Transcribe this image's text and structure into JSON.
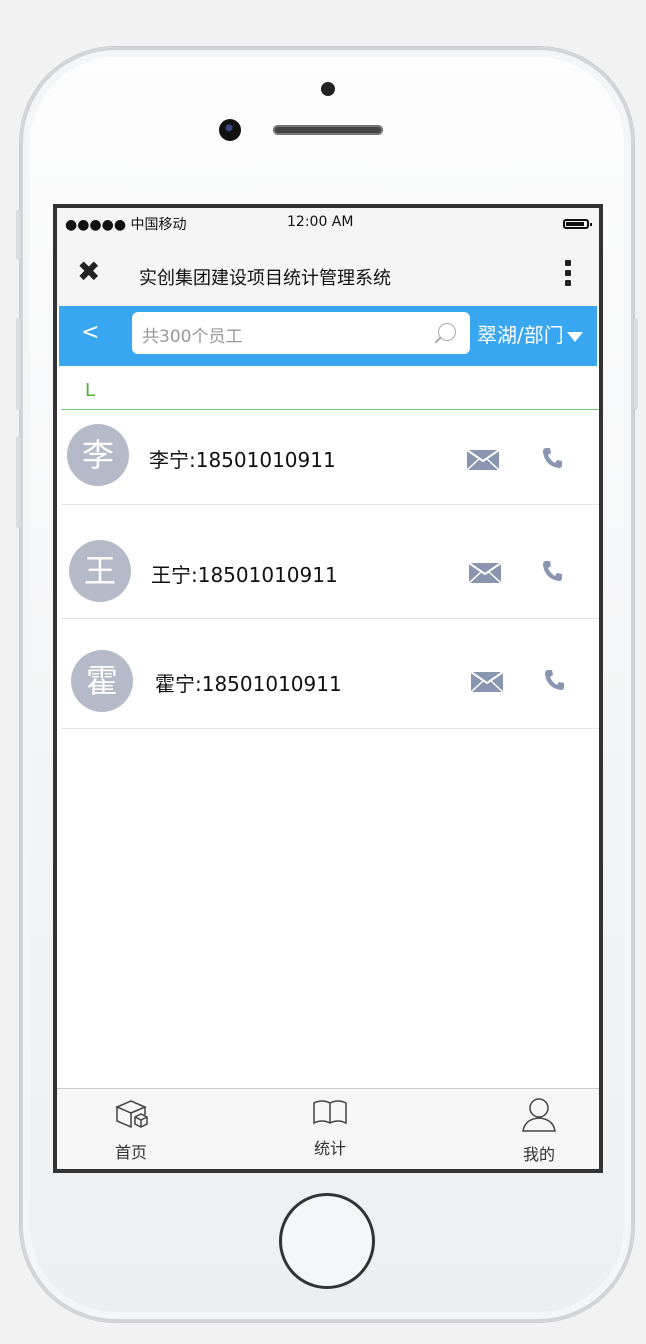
{
  "status": {
    "carrier": "●●●●● 中国移动",
    "time": "12:00 AM"
  },
  "header": {
    "title": "实创集团建设项目统计管理系统"
  },
  "toolbar": {
    "back_label": "<",
    "search_placeholder": "共300个员工",
    "department": "翠湖/部门"
  },
  "section_letter": "L",
  "contacts": [
    {
      "avatar": "李",
      "entry": "李宁:18501010911"
    },
    {
      "avatar": "王",
      "entry": "王宁:18501010911"
    },
    {
      "avatar": "霍",
      "entry": "霍宁:18501010911"
    }
  ],
  "tabs": [
    {
      "label": "首页",
      "icon": "box-icon"
    },
    {
      "label": "统计",
      "icon": "book-icon"
    },
    {
      "label": "我的",
      "icon": "user-icon"
    }
  ],
  "colors": {
    "accent": "#39a6f2",
    "avatar": "#b5bac8",
    "icon": "#8a96b0",
    "letter": "#4caf3a"
  }
}
